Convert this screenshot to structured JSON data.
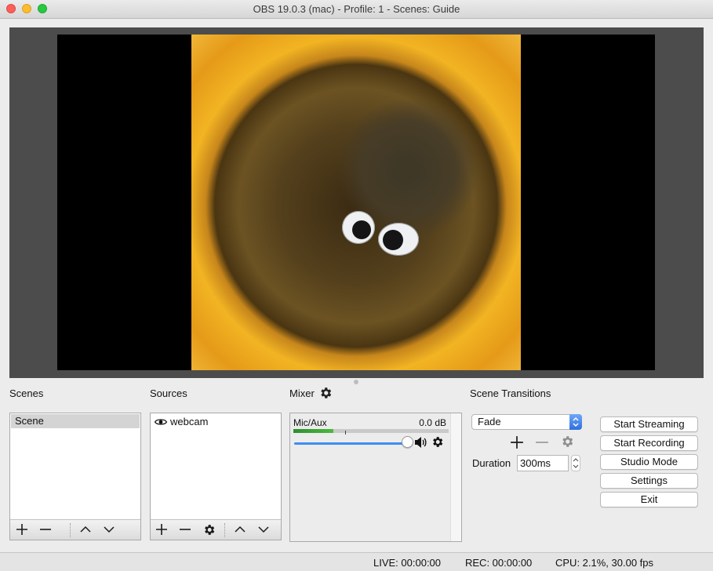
{
  "window": {
    "title": "OBS 19.0.3 (mac) - Profile: 1 - Scenes: Guide"
  },
  "docks": {
    "scenes_label": "Scenes",
    "sources_label": "Sources",
    "mixer_label": "Mixer",
    "transitions_label": "Scene Transitions"
  },
  "scenes": {
    "items": [
      "Scene"
    ]
  },
  "sources": {
    "items": [
      "webcam"
    ]
  },
  "mixer": {
    "channel_name": "Mic/Aux",
    "level": "0.0 dB",
    "volume_fraction": 1.0
  },
  "transitions": {
    "selected": "Fade",
    "duration_label": "Duration",
    "duration_value": "300ms"
  },
  "controls": {
    "start_streaming": "Start Streaming",
    "start_recording": "Start Recording",
    "studio_mode": "Studio Mode",
    "settings": "Settings",
    "exit": "Exit"
  },
  "status": {
    "live": "LIVE: 00:00:00",
    "rec": "REC: 00:00:00",
    "cpu": "CPU: 2.1%, 30.00 fps"
  },
  "icons": {
    "gear": "gear-icon",
    "plus": "plus-icon",
    "minus": "minus-icon",
    "up": "chevron-up-icon",
    "down": "chevron-down-icon",
    "eye": "eye-icon",
    "speaker": "speaker-icon"
  },
  "colors": {
    "accent": "#3d8ef0",
    "meter_green": "#2f8f2f",
    "preview_bg": "#4c4c4c"
  }
}
